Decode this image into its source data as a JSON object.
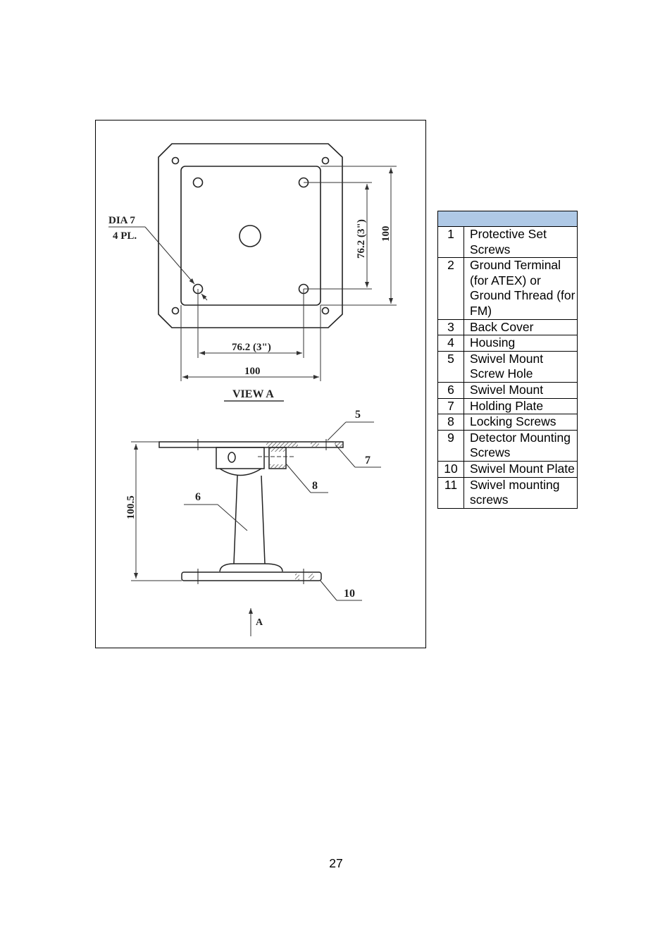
{
  "figure": {
    "top_view": {
      "hole_callout_line1": "DIA 7",
      "hole_callout_line2": "4 PL.",
      "dim_vertical_inner": "76.2 (3\")",
      "dim_vertical_outer": "100",
      "dim_horizontal_inner": "76.2 (3\")",
      "dim_horizontal_outer": "100",
      "view_label": "VIEW A"
    },
    "side_view": {
      "dim_height": "100.5",
      "callouts": [
        "5",
        "7",
        "8",
        "6",
        "10"
      ],
      "arrow_label": "A"
    }
  },
  "parts_table": {
    "header": "",
    "rows": [
      {
        "num": "1",
        "desc": "Protective Set Screws"
      },
      {
        "num": "2",
        "desc": "Ground Terminal (for ATEX) or Ground Thread (for FM)"
      },
      {
        "num": "3",
        "desc": "Back Cover"
      },
      {
        "num": "4",
        "desc": "Housing"
      },
      {
        "num": "5",
        "desc": "Swivel Mount Screw Hole"
      },
      {
        "num": "6",
        "desc": "Swivel Mount"
      },
      {
        "num": "7",
        "desc": "Holding Plate"
      },
      {
        "num": "8",
        "desc": "Locking Screws"
      },
      {
        "num": "9",
        "desc": "Detector Mounting Screws"
      },
      {
        "num": "10",
        "desc": "Swivel Mount Plate"
      },
      {
        "num": "11",
        "desc": "Swivel mounting screws"
      }
    ]
  },
  "page_number": "27"
}
